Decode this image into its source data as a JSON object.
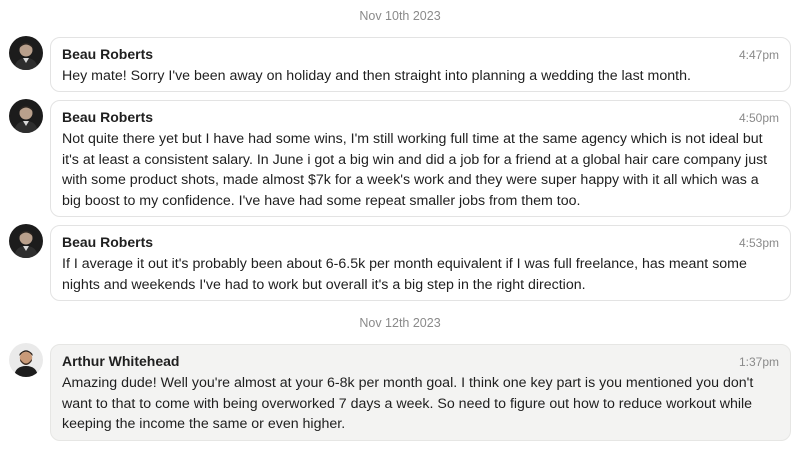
{
  "thread": {
    "separators": [
      "Nov 10th 2023",
      "Nov 12th 2023"
    ],
    "messages": [
      {
        "sender": "Beau Roberts",
        "time": "4:47pm",
        "avatar": "avatar-beau",
        "text": "Hey mate! Sorry I've been away on holiday and then straight into planning a wedding the last month."
      },
      {
        "sender": "Beau Roberts",
        "time": "4:50pm",
        "avatar": "avatar-beau",
        "text": "Not quite there yet but I have had some wins, I'm still working full time at the same agency which is not ideal but it's at least a consistent salary. In June i got a big win and did a job for a friend at a global hair care company just with some product shots, made almost $7k for a week's work and they were super happy with it all which was a big boost to my confidence. I've have had some repeat smaller jobs from them too."
      },
      {
        "sender": "Beau Roberts",
        "time": "4:53pm",
        "avatar": "avatar-beau",
        "text": "If I average it out it's probably been about 6-6.5k per month equivalent if I was full freelance, has meant some nights and weekends I've had to work but overall it's a big step in the right direction."
      },
      {
        "sender": "Arthur Whitehead",
        "time": "1:37pm",
        "avatar": "avatar-arthur",
        "text": "Amazing dude! Well you're almost at your 6-8k per month goal. I think one key part is you mentioned you don't want to that to come with being overworked 7 days a week. So need to figure out how to reduce workout while keeping the income the same or even higher."
      }
    ]
  }
}
